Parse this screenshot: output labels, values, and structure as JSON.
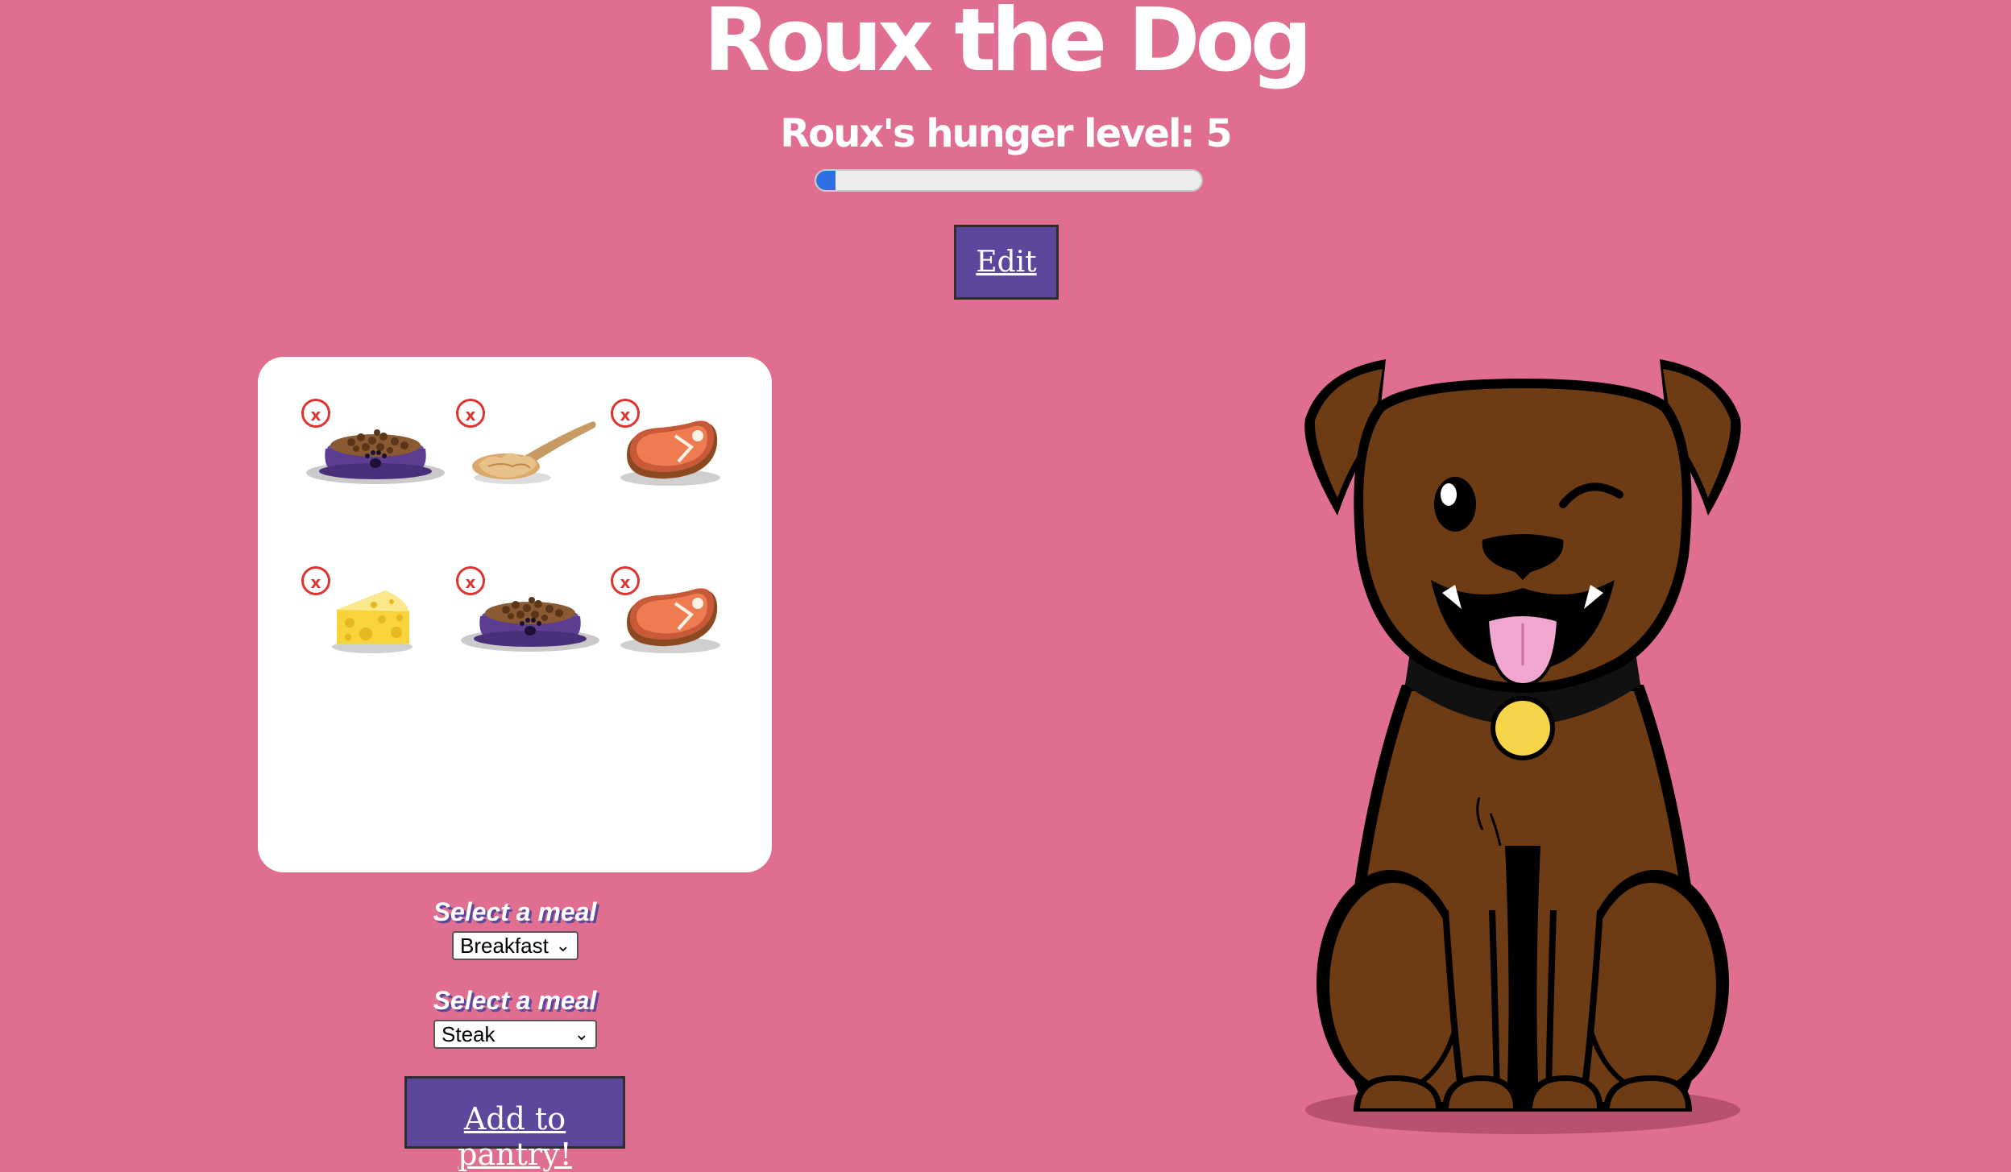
{
  "header": {
    "title": "Roux the Dog",
    "hunger_text": "Roux's hunger level: 5",
    "hunger_progress_percent": 5
  },
  "edit_button": {
    "label": "Edit"
  },
  "pantry": {
    "items": [
      {
        "food": "dog-food-bowl",
        "remove_label": "x"
      },
      {
        "food": "peanut-butter-spoon",
        "remove_label": "x"
      },
      {
        "food": "steak",
        "remove_label": "x"
      },
      {
        "food": "cheese",
        "remove_label": "x"
      },
      {
        "food": "dog-food-bowl",
        "remove_label": "x"
      },
      {
        "food": "steak",
        "remove_label": "x"
      }
    ]
  },
  "meal_select_1": {
    "label": "Select a meal",
    "value": "Breakfast"
  },
  "meal_select_2": {
    "label": "Select a meal",
    "value": "Steak"
  },
  "add_button": {
    "label": "Add to pantry!"
  },
  "colors": {
    "background": "#e06e90",
    "button": "#5c479c",
    "progress_fill": "#2f6fe4",
    "remove_icon": "#e0322f",
    "dog_fur": "#6e3c14"
  }
}
